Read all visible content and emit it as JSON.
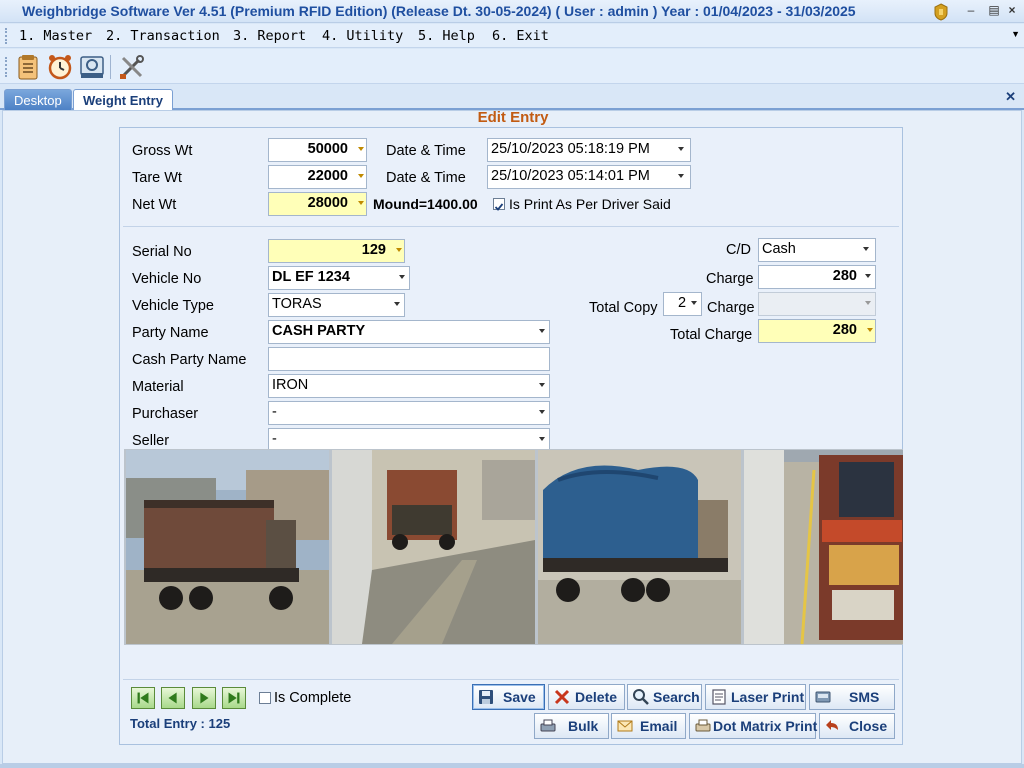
{
  "window": {
    "title": "Weighbridge Software Ver 4.51 (Premium RFID Edition) (Release Dt. 30-05-2024)  ( User : admin ) Year : 01/04/2023 - 31/03/2025"
  },
  "menu": [
    "1. Master",
    "2. Transaction",
    "3. Report",
    "4. Utility",
    "5. Help",
    "6. Exit"
  ],
  "tabs": {
    "desktop": "Desktop",
    "weight_entry": "Weight Entry"
  },
  "form": {
    "title": "Edit Entry",
    "gross_wt": {
      "label": "Gross Wt",
      "value": "50000"
    },
    "tare_wt": {
      "label": "Tare Wt",
      "value": "22000"
    },
    "net_wt": {
      "label": "Net Wt",
      "value": "28000"
    },
    "gross_datetime": {
      "label": "Date & Time",
      "value": "25/10/2023 05:18:19 PM"
    },
    "tare_datetime": {
      "label": "Date & Time",
      "value": "25/10/2023 05:14:01 PM"
    },
    "mound": "Mound=1400.00",
    "print_as_driver": {
      "label": "Is Print As Per Driver Said",
      "checked": true
    },
    "serial_no": {
      "label": "Serial No",
      "value": "129"
    },
    "vehicle_no": {
      "label": "Vehicle No",
      "value": "DL EF 1234"
    },
    "vehicle_type": {
      "label": "Vehicle Type",
      "value": "TORAS"
    },
    "party_name": {
      "label": "Party Name",
      "value": "CASH PARTY"
    },
    "cash_party_name": {
      "label": "Cash Party Name",
      "value": ""
    },
    "material": {
      "label": "Material",
      "value": "IRON"
    },
    "purchaser": {
      "label": "Purchaser",
      "value": "-"
    },
    "seller": {
      "label": "Seller",
      "value": "-"
    },
    "cd": {
      "label": "C/D",
      "value": "Cash"
    },
    "charge": {
      "label": "Charge",
      "value": "280"
    },
    "total_copy": {
      "label": "Total Copy",
      "value": "2"
    },
    "copy_charge": {
      "label": "Charge",
      "value": ""
    },
    "total_charge": {
      "label": "Total Charge",
      "value": "280"
    }
  },
  "footer": {
    "is_complete": {
      "label": "Is Complete",
      "checked": false
    },
    "total_entry": "Total Entry : 125"
  },
  "buttons": {
    "save": "Save",
    "delete": "Delete",
    "search": "Search",
    "laser_print": "Laser Print",
    "sms": "SMS",
    "bulk": "Bulk",
    "email": "Email",
    "dot_matrix_print": "Dot Matrix Print",
    "close": "Close"
  },
  "icons": [
    "report-icon",
    "alarm-clock-icon",
    "backup-icon",
    "tools-icon",
    "first-record-icon",
    "previous-record-icon",
    "next-record-icon",
    "last-record-icon",
    "save-icon",
    "delete-icon",
    "search-icon",
    "print-icon",
    "sms-icon",
    "bulk-icon",
    "email-icon",
    "dot-matrix-icon",
    "close-icon"
  ],
  "colors": {
    "title_text": "#1f4fa0",
    "edit_title": "#c25b12",
    "highlight_field": "#ffffb8",
    "button_text": "#1b3f7a"
  }
}
